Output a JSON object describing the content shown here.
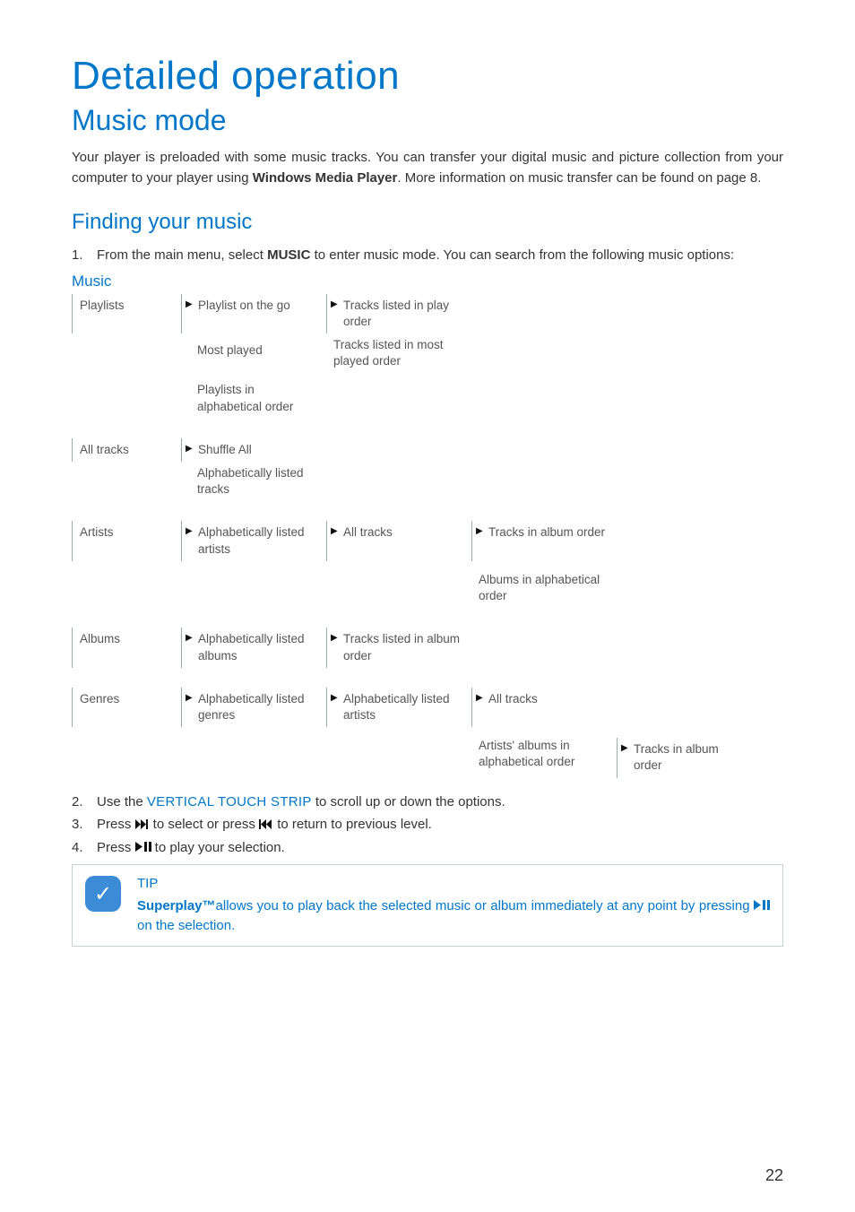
{
  "page_title": "Detailed operation",
  "section_title": "Music mode",
  "intro": {
    "part1": "Your player is preloaded with some music tracks. You can transfer your digital music and picture collection from your computer to your player using ",
    "bold": "Windows Media Player",
    "part2": ". More information on music transfer can be found on page 8."
  },
  "sub_heading": "Finding your music",
  "step1": {
    "num": "1.",
    "pre": "From the main menu, select ",
    "bold": "MUSIC",
    "post": " to enter music mode. You can search from the following music options:"
  },
  "table_heading": "Music",
  "nav": {
    "playlists": {
      "root": "Playlists",
      "l2a": "Playlist on the go",
      "l2b": "Most played",
      "l2c": "Playlists in alphabetical order",
      "l3a": "Tracks listed in play order",
      "l3b": "Tracks listed in most played order"
    },
    "alltracks": {
      "root": "All tracks",
      "l2a": "Shuffle All",
      "l2b": "Alphabetically listed tracks"
    },
    "artists": {
      "root": "Artists",
      "l2": "Alphabetically listed artists",
      "l3": "All tracks",
      "l4a": "Tracks in album order",
      "l4b": "Albums in alphabetical order"
    },
    "albums": {
      "root": "Albums",
      "l2": "Alphabetically listed albums",
      "l3": "Tracks listed in album order"
    },
    "genres": {
      "root": "Genres",
      "l2": "Alphabetically listed genres",
      "l3": "Alphabetically listed artists",
      "l4a": "All tracks",
      "l4b": "Artists' albums in alphabetical order",
      "l5": "Tracks in album order"
    }
  },
  "step2": {
    "num": "2.",
    "pre": "Use the ",
    "sc": "VERTICAL TOUCH STRIP",
    "post": " to scroll up or down the options."
  },
  "step3": {
    "num": "3.",
    "pre": "Press ",
    "mid": " to select or press ",
    "post": " to return to previous level."
  },
  "step4": {
    "num": "4.",
    "pre": "Press ",
    "post": " to play your selection."
  },
  "tip": {
    "heading": "TIP",
    "brand": "Superplay™",
    "line1": "allows you to play back the selected music or album immediately at any point by pressing ",
    "line2": " on the selection."
  },
  "page_number": "22"
}
